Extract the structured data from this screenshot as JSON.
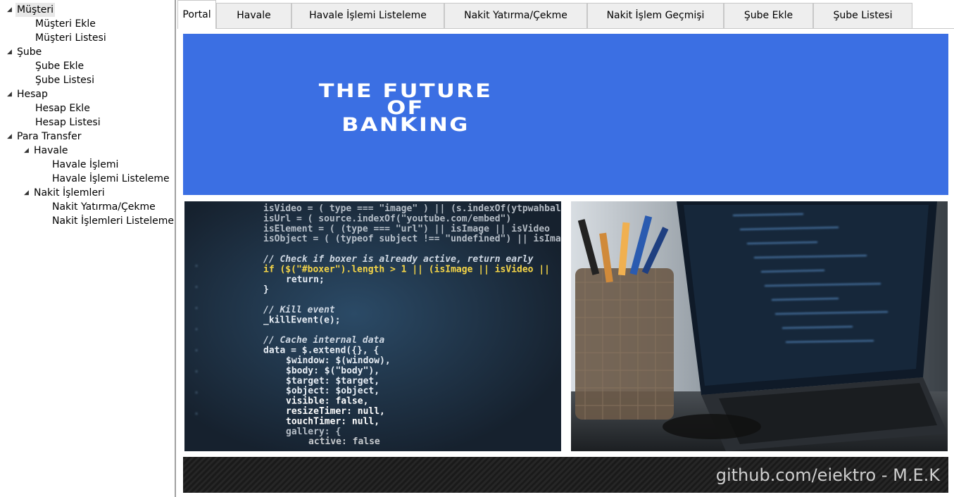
{
  "tree": {
    "nodes": [
      {
        "label": "Müşteri",
        "expanded": true
      },
      {
        "label": "Müşteri Ekle"
      },
      {
        "label": "Müşteri Listesi"
      },
      {
        "label": "Şube",
        "expanded": true
      },
      {
        "label": "Şube Ekle"
      },
      {
        "label": "Şube Listesi"
      },
      {
        "label": "Hesap",
        "expanded": true
      },
      {
        "label": "Hesap Ekle"
      },
      {
        "label": "Hesap Listesi"
      },
      {
        "label": "Para Transfer",
        "expanded": true
      },
      {
        "label": "Havale",
        "expanded": true
      },
      {
        "label": "Havale İşlemi"
      },
      {
        "label": "Havale İşlemi Listeleme"
      },
      {
        "label": "Nakit İşlemleri",
        "expanded": true
      },
      {
        "label": "Nakit Yatırma/Çekme"
      },
      {
        "label": "Nakit İşlemleri Listeleme"
      }
    ],
    "expander_glyph": "◢"
  },
  "tabs": [
    {
      "label": "Portal",
      "active": true
    },
    {
      "label": "Havale"
    },
    {
      "label": "Havale İşlemi Listeleme"
    },
    {
      "label": "Nakit Yatırma/Çekme"
    },
    {
      "label": "Nakit İşlem Geçmişi"
    },
    {
      "label": "Şube Ekle"
    },
    {
      "label": "Şube Listesi"
    }
  ],
  "banner": {
    "line1": "THE FUTURE",
    "line2": "OF",
    "line3": "BANKING",
    "background": "#3b6fe3"
  },
  "code_image": {
    "lines": [
      "isVideo = ( type === \"image\" ) || (s.indexOf(ytpwahbalasion,",
      "isUrl   = ( source.indexOf(\"youtube.com/embed\")",
      "isElement = ( (type === \"url\") || isImage || isVideo",
      "isObject  = ( (typeof subject !== \"undefined\") || isImage",
      "",
      "// Check if boxer is already active, return early",
      "if ($(\"#boxer\").length > 1 || (isImage || isVideo ||",
      "    return;",
      "}",
      "",
      "// Kill event",
      "_killEvent(e);",
      "",
      "// Cache internal data",
      "data = $.extend({}, {",
      "    $window: $(window),",
      "    $body: $(\"body\"),",
      "    $target: $target,",
      "    $object: $object,",
      "    visible: false,",
      "    resizeTimer: null,",
      "    touchTimer: null,",
      "    gallery: {",
      "        active: false"
    ]
  },
  "footer": {
    "text": "github.com/eiektro - M.E.K"
  }
}
